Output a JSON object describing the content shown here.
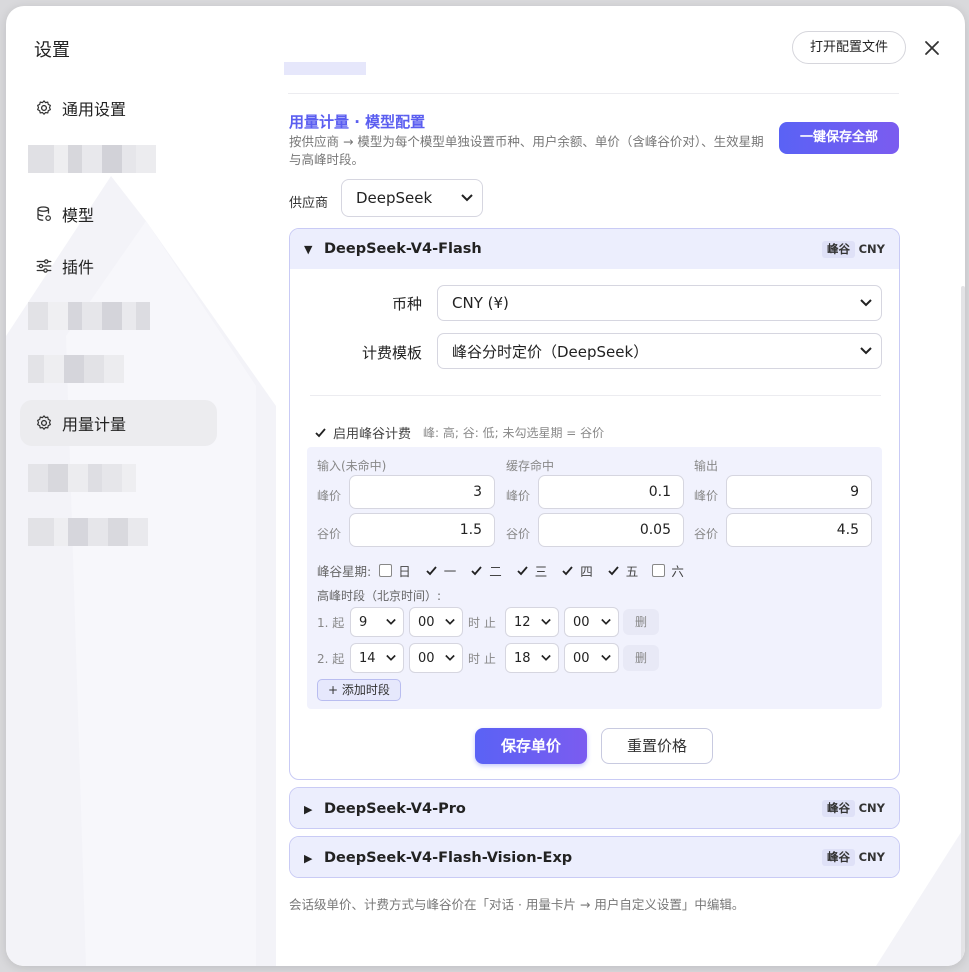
{
  "dialog": {
    "title": "设置",
    "open_config_label": "打开配置文件"
  },
  "sidebar": {
    "items": [
      {
        "label": "通用设置",
        "icon": "gear-icon"
      },
      {
        "label": "模型",
        "icon": "database-icon"
      },
      {
        "label": "插件",
        "icon": "sliders-icon"
      },
      {
        "label": "用量计量",
        "icon": "gear-icon",
        "active": true
      }
    ]
  },
  "section": {
    "title": "用量计量 · 模型配置",
    "description": "按供应商 → 模型为每个模型单独设置币种、用户余额、单价（含峰谷价对）、生效星期与高峰时段。",
    "save_all_label": "一键保存全部",
    "vendor_label": "供应商",
    "vendor_value": "DeepSeek"
  },
  "models": [
    {
      "name": "DeepSeek-V4-Flash",
      "expanded": true,
      "badge_peak": "峰谷",
      "currency_badge": "CNY",
      "currency_label": "币种",
      "currency_value": "CNY (¥)",
      "template_label": "计费模板",
      "template_value": "峰谷分时定价（DeepSeek）",
      "peak_enable_label": "启用峰谷计费",
      "peak_enable_checked": true,
      "peak_hint": "峰: 高; 谷: 低; 未勾选星期 = 谷价",
      "columns": [
        "输入(未命中)",
        "缓存命中",
        "输出"
      ],
      "peak_label": "峰价",
      "valley_label": "谷价",
      "peak_prices": [
        "3",
        "0.1",
        "9"
      ],
      "valley_prices": [
        "1.5",
        "0.05",
        "4.5"
      ],
      "weekday_label": "峰谷星期:",
      "weekdays": [
        {
          "label": "日",
          "checked": false
        },
        {
          "label": "一",
          "checked": true
        },
        {
          "label": "二",
          "checked": true
        },
        {
          "label": "三",
          "checked": true
        },
        {
          "label": "四",
          "checked": true
        },
        {
          "label": "五",
          "checked": true
        },
        {
          "label": "六",
          "checked": false
        }
      ],
      "peak_hours_label": "高峰时段（北京时间）:",
      "segments": [
        {
          "index": "1. 起",
          "start_h": "9",
          "start_m": "00",
          "mid": "时 止",
          "end_h": "12",
          "end_m": "00",
          "del": "删"
        },
        {
          "index": "2. 起",
          "start_h": "14",
          "start_m": "00",
          "mid": "时 止",
          "end_h": "18",
          "end_m": "00",
          "del": "删"
        }
      ],
      "add_segment_label": "+ 添加时段",
      "save_label": "保存单价",
      "reset_label": "重置价格"
    },
    {
      "name": "DeepSeek-V4-Pro",
      "expanded": false,
      "badge_peak": "峰谷",
      "currency_badge": "CNY"
    },
    {
      "name": "DeepSeek-V4-Flash-Vision-Exp",
      "expanded": false,
      "badge_peak": "峰谷",
      "currency_badge": "CNY"
    }
  ],
  "footnote": "会话级单价、计费方式与峰谷价在「对话 · 用量卡片 → 用户自定义设置」中编辑。",
  "colors": {
    "accent": "#5b5ef0",
    "card_border": "#c9cbf5",
    "card_header": "#eceefd",
    "panel": "#f1f2fd"
  }
}
